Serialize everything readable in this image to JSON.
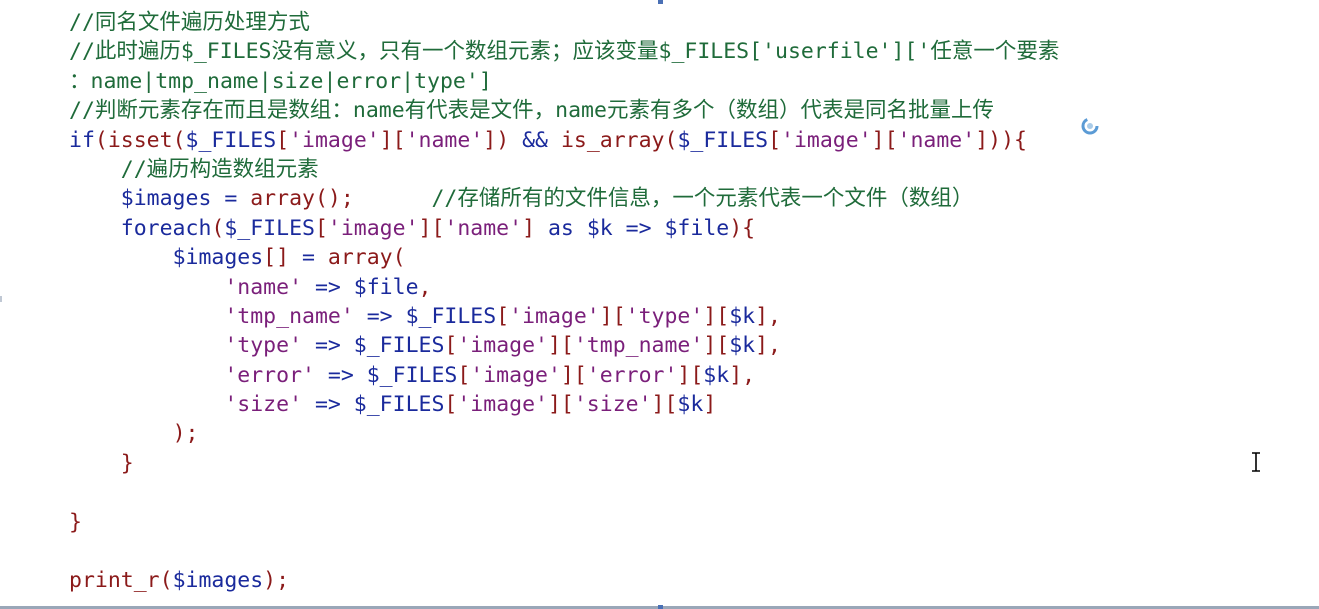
{
  "editor": {
    "lines": [
      [
        {
          "t": "//同名文件遍历处理方式",
          "c": "comment"
        }
      ],
      [
        {
          "t": "//此时遍历$_FILES没有意义，只有一个数组元素；应该变量$_FILES['userfile']['任意一个要素",
          "c": "comment"
        }
      ],
      [
        {
          "t": "：name|tmp_name|size|error|type']",
          "c": "comment"
        }
      ],
      [
        {
          "t": "//判断元素存在而且是数组：name有代表是文件，name元素有多个（数组）代表是同名批量上传",
          "c": "comment"
        }
      ],
      [
        {
          "t": "if",
          "c": "keyword"
        },
        {
          "t": "(",
          "c": "punct"
        },
        {
          "t": "isset",
          "c": "func"
        },
        {
          "t": "(",
          "c": "punct"
        },
        {
          "t": "$_FILES",
          "c": "var"
        },
        {
          "t": "[",
          "c": "punct"
        },
        {
          "t": "'image'",
          "c": "string"
        },
        {
          "t": "][",
          "c": "punct"
        },
        {
          "t": "'name'",
          "c": "string"
        },
        {
          "t": "]) ",
          "c": "punct"
        },
        {
          "t": "&&",
          "c": "op"
        },
        {
          "t": " ",
          "c": "plain"
        },
        {
          "t": "is_array",
          "c": "func"
        },
        {
          "t": "(",
          "c": "punct"
        },
        {
          "t": "$_FILES",
          "c": "var"
        },
        {
          "t": "[",
          "c": "punct"
        },
        {
          "t": "'image'",
          "c": "string"
        },
        {
          "t": "][",
          "c": "punct"
        },
        {
          "t": "'name'",
          "c": "string"
        },
        {
          "t": "])){",
          "c": "punct"
        }
      ],
      [
        {
          "t": "    ",
          "c": "plain"
        },
        {
          "t": "//遍历构造数组元素",
          "c": "comment"
        }
      ],
      [
        {
          "t": "    ",
          "c": "plain"
        },
        {
          "t": "$images",
          "c": "var"
        },
        {
          "t": " = ",
          "c": "op"
        },
        {
          "t": "array",
          "c": "func"
        },
        {
          "t": "();",
          "c": "punct"
        },
        {
          "t": "      ",
          "c": "plain"
        },
        {
          "t": "//存储所有的文件信息，一个元素代表一个文件（数组）",
          "c": "comment"
        }
      ],
      [
        {
          "t": "    ",
          "c": "plain"
        },
        {
          "t": "foreach",
          "c": "keyword"
        },
        {
          "t": "(",
          "c": "punct"
        },
        {
          "t": "$_FILES",
          "c": "var"
        },
        {
          "t": "[",
          "c": "punct"
        },
        {
          "t": "'image'",
          "c": "string"
        },
        {
          "t": "][",
          "c": "punct"
        },
        {
          "t": "'name'",
          "c": "string"
        },
        {
          "t": "] ",
          "c": "punct"
        },
        {
          "t": "as",
          "c": "keyword"
        },
        {
          "t": " ",
          "c": "plain"
        },
        {
          "t": "$k",
          "c": "var"
        },
        {
          "t": " => ",
          "c": "op"
        },
        {
          "t": "$file",
          "c": "var"
        },
        {
          "t": "){",
          "c": "punct"
        }
      ],
      [
        {
          "t": "        ",
          "c": "plain"
        },
        {
          "t": "$images",
          "c": "var"
        },
        {
          "t": "[]",
          "c": "punct"
        },
        {
          "t": " = ",
          "c": "op"
        },
        {
          "t": "array",
          "c": "func"
        },
        {
          "t": "(",
          "c": "punct"
        }
      ],
      [
        {
          "t": "            ",
          "c": "plain"
        },
        {
          "t": "'name'",
          "c": "string"
        },
        {
          "t": " => ",
          "c": "op"
        },
        {
          "t": "$file",
          "c": "var"
        },
        {
          "t": ",",
          "c": "punct"
        }
      ],
      [
        {
          "t": "            ",
          "c": "plain"
        },
        {
          "t": "'tmp_name'",
          "c": "string"
        },
        {
          "t": " => ",
          "c": "op"
        },
        {
          "t": "$_FILES",
          "c": "var"
        },
        {
          "t": "[",
          "c": "punct"
        },
        {
          "t": "'image'",
          "c": "string"
        },
        {
          "t": "][",
          "c": "punct"
        },
        {
          "t": "'type'",
          "c": "string"
        },
        {
          "t": "][",
          "c": "punct"
        },
        {
          "t": "$k",
          "c": "var"
        },
        {
          "t": "],",
          "c": "punct"
        }
      ],
      [
        {
          "t": "            ",
          "c": "plain"
        },
        {
          "t": "'type'",
          "c": "string"
        },
        {
          "t": " => ",
          "c": "op"
        },
        {
          "t": "$_FILES",
          "c": "var"
        },
        {
          "t": "[",
          "c": "punct"
        },
        {
          "t": "'image'",
          "c": "string"
        },
        {
          "t": "][",
          "c": "punct"
        },
        {
          "t": "'tmp_name'",
          "c": "string"
        },
        {
          "t": "][",
          "c": "punct"
        },
        {
          "t": "$k",
          "c": "var"
        },
        {
          "t": "],",
          "c": "punct"
        }
      ],
      [
        {
          "t": "            ",
          "c": "plain"
        },
        {
          "t": "'error'",
          "c": "string"
        },
        {
          "t": " => ",
          "c": "op"
        },
        {
          "t": "$_FILES",
          "c": "var"
        },
        {
          "t": "[",
          "c": "punct"
        },
        {
          "t": "'image'",
          "c": "string"
        },
        {
          "t": "][",
          "c": "punct"
        },
        {
          "t": "'error'",
          "c": "string"
        },
        {
          "t": "][",
          "c": "punct"
        },
        {
          "t": "$k",
          "c": "var"
        },
        {
          "t": "],",
          "c": "punct"
        }
      ],
      [
        {
          "t": "            ",
          "c": "plain"
        },
        {
          "t": "'size'",
          "c": "string"
        },
        {
          "t": " => ",
          "c": "op"
        },
        {
          "t": "$_FILES",
          "c": "var"
        },
        {
          "t": "[",
          "c": "punct"
        },
        {
          "t": "'image'",
          "c": "string"
        },
        {
          "t": "][",
          "c": "punct"
        },
        {
          "t": "'size'",
          "c": "string"
        },
        {
          "t": "][",
          "c": "punct"
        },
        {
          "t": "$k",
          "c": "var"
        },
        {
          "t": "]",
          "c": "punct"
        }
      ],
      [
        {
          "t": "        ",
          "c": "plain"
        },
        {
          "t": ");",
          "c": "punct"
        }
      ],
      [
        {
          "t": "    ",
          "c": "plain"
        },
        {
          "t": "}",
          "c": "punct"
        }
      ],
      [],
      [
        {
          "t": "}",
          "c": "punct"
        }
      ],
      [],
      [
        {
          "t": "print_r",
          "c": "func"
        },
        {
          "t": "(",
          "c": "punct"
        },
        {
          "t": "$images",
          "c": "var"
        },
        {
          "t": ");",
          "c": "punct"
        }
      ]
    ]
  },
  "icons": {
    "busy": "busy-spinner-icon",
    "text_cursor": "text-cursor-icon"
  },
  "colors": {
    "comment": "#1f6b3a",
    "keyword": "#1a2a9c",
    "function": "#8b1a1a",
    "variable": "#1a2a9c",
    "string": "#7a1f7a",
    "background": "#ffffff"
  }
}
